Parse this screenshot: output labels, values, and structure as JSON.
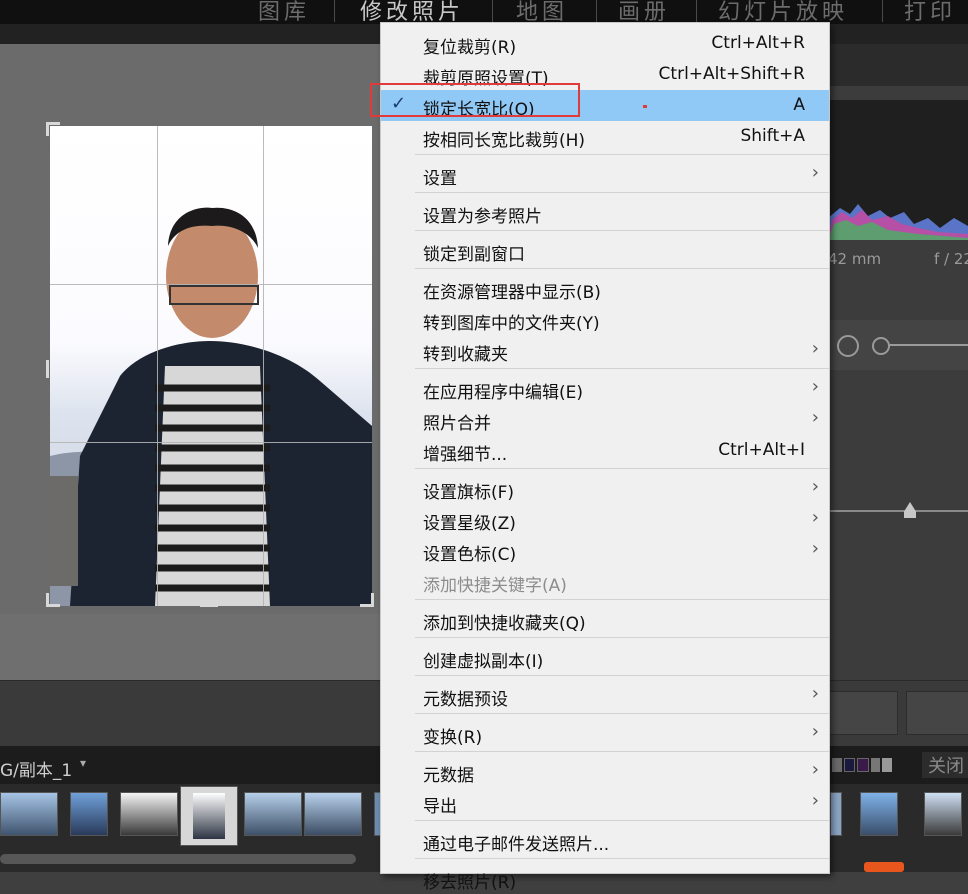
{
  "modules": [
    {
      "label": "图库",
      "active": false
    },
    {
      "label": "修改照片",
      "active": true
    },
    {
      "label": "地图",
      "active": false
    },
    {
      "label": "画册",
      "active": false
    },
    {
      "label": "幻灯片放映",
      "active": false
    },
    {
      "label": "打印",
      "active": false
    }
  ],
  "filmstrip": {
    "source_label": "G/副本_1",
    "dropdown_glyph": "▾"
  },
  "right_panel": {
    "focal_length": "42 mm",
    "aperture": "f / 22",
    "close_label": "关闭"
  },
  "menu": {
    "checkmark": "✓",
    "arrow_glyph": "›",
    "items": [
      {
        "label": "复位裁剪(R)",
        "shortcut": "Ctrl+Alt+R"
      },
      {
        "label": "裁剪原照设置(T)",
        "shortcut": "Ctrl+Alt+Shift+R"
      },
      {
        "label": "锁定长宽比(O)",
        "shortcut": "A",
        "checked": true,
        "highlighted": true
      },
      {
        "label": "按相同长宽比裁剪(H)",
        "shortcut": "Shift+A"
      },
      {
        "label": "设置",
        "submenu": true
      },
      {
        "label": "设置为参考照片"
      },
      {
        "label": "锁定到副窗口"
      },
      {
        "label": "在资源管理器中显示(B)"
      },
      {
        "label": "转到图库中的文件夹(Y)"
      },
      {
        "label": "转到收藏夹",
        "submenu": true
      },
      {
        "label": "在应用程序中编辑(E)",
        "submenu": true
      },
      {
        "label": "照片合并",
        "submenu": true
      },
      {
        "label": "增强细节...",
        "shortcut": "Ctrl+Alt+I"
      },
      {
        "label": "设置旗标(F)",
        "submenu": true
      },
      {
        "label": "设置星级(Z)",
        "submenu": true
      },
      {
        "label": "设置色标(C)",
        "submenu": true
      },
      {
        "label": "添加快捷关键字(A)",
        "disabled": true
      },
      {
        "label": "添加到快捷收藏夹(Q)"
      },
      {
        "label": "创建虚拟副本(I)"
      },
      {
        "label": "元数据预设",
        "submenu": true
      },
      {
        "label": "变换(R)",
        "submenu": true
      },
      {
        "label": "元数据",
        "submenu": true
      },
      {
        "label": "导出",
        "submenu": true
      },
      {
        "label": "通过电子邮件发送照片..."
      },
      {
        "label": "移去照片(R)"
      }
    ]
  },
  "colors": {
    "highlight": "#90c8f6",
    "annotation_box": "#e03a3a"
  }
}
